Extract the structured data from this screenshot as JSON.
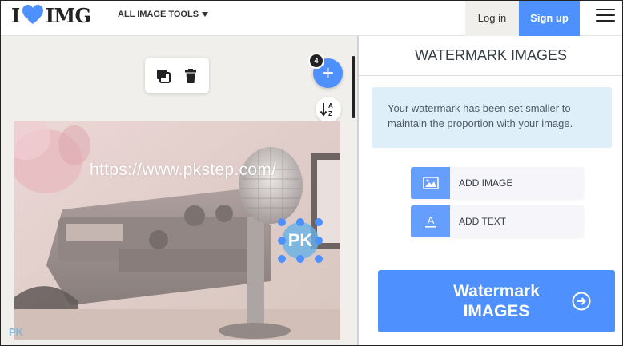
{
  "header": {
    "logo_left": "I",
    "logo_right": "IMG",
    "tools_menu_label": "ALL IMAGE TOOLS",
    "login_label": "Log in",
    "signup_label": "Sign up"
  },
  "workspace": {
    "file_count": "4",
    "watermark_text": "https://www.pkstep.com/",
    "watermark_image_text": "PK",
    "corner_mark_text": "PK"
  },
  "sidebar": {
    "title": "WATERMARK IMAGES",
    "info_message": "Your watermark has been set smaller to maintain the proportion with your image.",
    "add_image_label": "ADD IMAGE",
    "add_text_label": "ADD TEXT",
    "submit_label_line1": "Watermark",
    "submit_label_line2": "IMAGES"
  },
  "colors": {
    "accent": "#4d90fe",
    "info_bg": "#deeff9",
    "workspace_bg": "#f1efeb"
  }
}
